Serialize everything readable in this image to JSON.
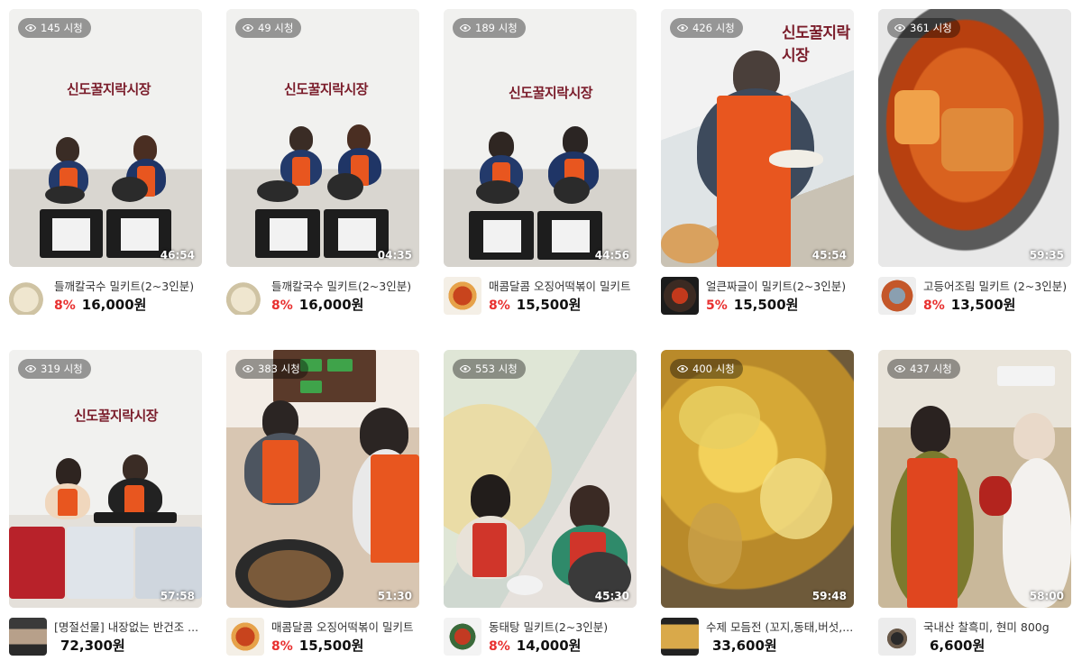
{
  "cards": [
    {
      "views": "145 시청",
      "duration": "46:54",
      "name": "들깨칼국수 밀키트(2~3인분)",
      "discount": "8%",
      "price": "16,000원"
    },
    {
      "views": "49 시청",
      "duration": "04:35",
      "name": "들깨칼국수 밀키트(2~3인분)",
      "discount": "8%",
      "price": "16,000원"
    },
    {
      "views": "189 시청",
      "duration": "44:56",
      "name": "매콤달콤 오징어떡볶이 밀키트",
      "discount": "8%",
      "price": "15,500원"
    },
    {
      "views": "426 시청",
      "duration": "45:54",
      "name": "얼큰짜글이 밀키트(2~3인분)",
      "discount": "5%",
      "price": "15,500원"
    },
    {
      "views": "361 시청",
      "duration": "59:35",
      "name": "고등어조림 밀키트 (2~3인분)",
      "discount": "8%",
      "price": "13,500원"
    },
    {
      "views": "319 시청",
      "duration": "57:58",
      "name": "[명절선물] 내장없는 반건조 ...",
      "discount": "",
      "price": "72,300원"
    },
    {
      "views": "383 시청",
      "duration": "51:30",
      "name": "매콤달콤 오징어떡볶이 밀키트",
      "discount": "8%",
      "price": "15,500원"
    },
    {
      "views": "553 시청",
      "duration": "45:30",
      "name": "동태탕 밀키트(2~3인분)",
      "discount": "8%",
      "price": "14,000원"
    },
    {
      "views": "400 시청",
      "duration": "59:48",
      "name": "수제 모듬전 (꼬지,동태,버섯,...",
      "discount": "",
      "price": "33,600원"
    },
    {
      "views": "437 시청",
      "duration": "58:00",
      "name": "국내산 찰흑미, 현미 800g",
      "discount": "",
      "price": "6,600원"
    }
  ],
  "logo_text": "신도꿀지락시장",
  "colors": {
    "discount": "#e8302f",
    "apron": "#e8561f"
  },
  "icons": {
    "views": "eye-icon"
  }
}
